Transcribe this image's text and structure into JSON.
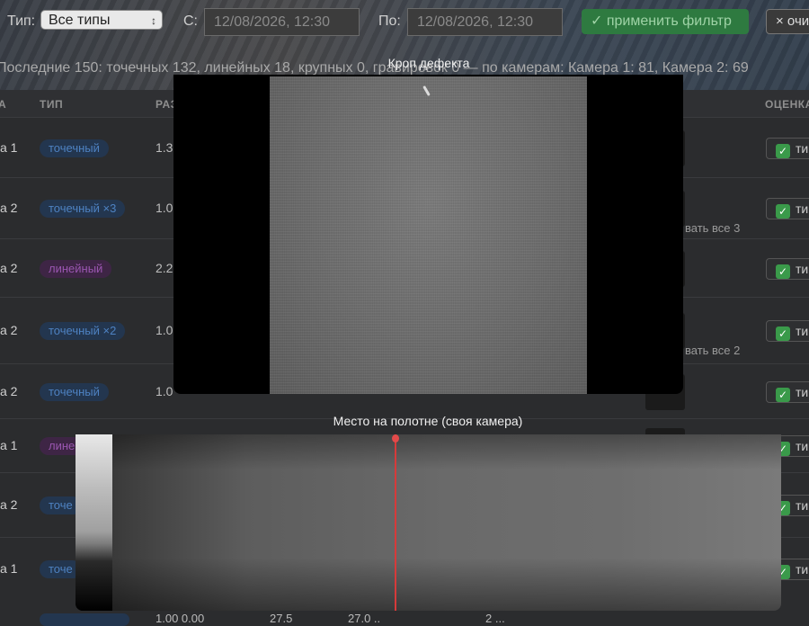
{
  "filters": {
    "type_label": "Тип:",
    "type_value": "Все типы",
    "from_label": "С:",
    "from_value": "12/08/2026, 12:30",
    "to_label": "По:",
    "to_value": "12/08/2026, 12:30",
    "apply_label": "✓ применить фильтр",
    "clear_label": "× очи"
  },
  "summary": "Последние 150: точечных 132, линейных 18, крупных 0, гравировок 0 — по камерам: Камера 1: 81, Камера 2: 69",
  "table": {
    "headers": [
      "А",
      "ТИП",
      "РАЗ",
      "ОЦЕНКА"
    ],
    "rows": [
      {
        "camera": "а 1",
        "type": "точечный",
        "kind": "point",
        "size": "1.3",
        "grade": "ти",
        "showall": ""
      },
      {
        "camera": "а 2",
        "type": "точечный ×3",
        "kind": "point",
        "size": "1.0",
        "grade": "ти",
        "showall": "вать все 3"
      },
      {
        "camera": "а 2",
        "type": "линейный",
        "kind": "linear",
        "size": "2.2",
        "grade": "ти",
        "showall": ""
      },
      {
        "camera": "а 2",
        "type": "точечный ×2",
        "kind": "point",
        "size": "1.0",
        "grade": "ти",
        "showall": "вать все 2"
      },
      {
        "camera": "а 2",
        "type": "точечный",
        "kind": "point",
        "size": "1.0",
        "grade": "ти",
        "showall": ""
      },
      {
        "camera": "а 1",
        "type": "лине",
        "kind": "linear",
        "size": "",
        "grade": "ти",
        "showall": ""
      },
      {
        "camera": "а 2",
        "type": "точе",
        "kind": "point",
        "size": "",
        "grade": "ти",
        "showall": ""
      },
      {
        "camera": "а 1",
        "type": "точе",
        "kind": "point",
        "size": "",
        "grade": "ти",
        "showall": ""
      }
    ],
    "bottom_values": [
      "1.00 0.00",
      "27.5",
      "27.0 ..",
      "2 ..."
    ]
  },
  "modal": {
    "crop_title": "Кроп дефекта",
    "place_title": "Место на полотне (своя камера)"
  },
  "colors": {
    "accent_green": "#2e7a40",
    "marker_red": "#d63a3a",
    "badge_point": "#4e82c2",
    "badge_linear": "#9a56b0"
  }
}
